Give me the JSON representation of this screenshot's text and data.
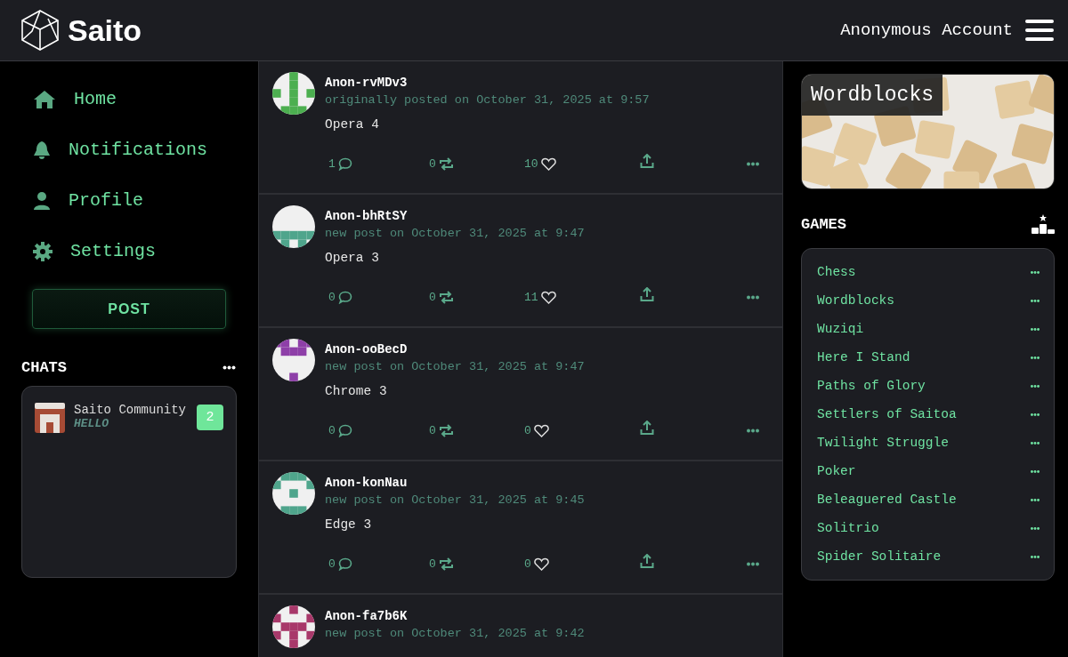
{
  "header": {
    "logo": "Saito",
    "account": "Anonymous Account"
  },
  "nav": [
    {
      "kind": "home",
      "label": "Home"
    },
    {
      "kind": "bell",
      "label": "Notifications"
    },
    {
      "kind": "user",
      "label": "Profile"
    },
    {
      "kind": "gear",
      "label": "Settings"
    }
  ],
  "post_button": "POST",
  "chats": {
    "title": "CHATS",
    "items": [
      {
        "name": "Saito Community",
        "preview": "HELLO",
        "unread": "2"
      }
    ]
  },
  "posts": [
    {
      "author": "Anon-rvMDv3",
      "color": "#4caf50",
      "meta": "originally posted on October 31, 2025 at 9:57",
      "text": "Opera 4",
      "comments": "1",
      "reposts": "0",
      "likes": "10"
    },
    {
      "author": "Anon-bhRtSY",
      "color": "#4fa58c",
      "meta": "new post on October 31, 2025 at 9:47",
      "text": "Opera 3",
      "comments": "0",
      "reposts": "0",
      "likes": "11"
    },
    {
      "author": "Anon-ooBecD",
      "color": "#8e3fa8",
      "meta": "new post on October 31, 2025 at 9:47",
      "text": "Chrome 3",
      "comments": "0",
      "reposts": "0",
      "likes": "0"
    },
    {
      "author": "Anon-konNau",
      "color": "#4fa58c",
      "meta": "new post on October 31, 2025 at 9:45",
      "text": "Edge 3",
      "comments": "0",
      "reposts": "0",
      "likes": "0"
    },
    {
      "author": "Anon-fa7b6K",
      "color": "#a8386a",
      "meta": "new post on October 31, 2025 at 9:42"
    }
  ],
  "featured": {
    "title": "Wordblocks"
  },
  "games": {
    "title": "GAMES",
    "items": [
      "Chess",
      "Wordblocks",
      "Wuziqi",
      "Here I Stand",
      "Paths of Glory",
      "Settlers of Saitoa",
      "Twilight Struggle",
      "Poker",
      "Beleaguered Castle",
      "Solitrio",
      "Spider Solitaire"
    ]
  }
}
